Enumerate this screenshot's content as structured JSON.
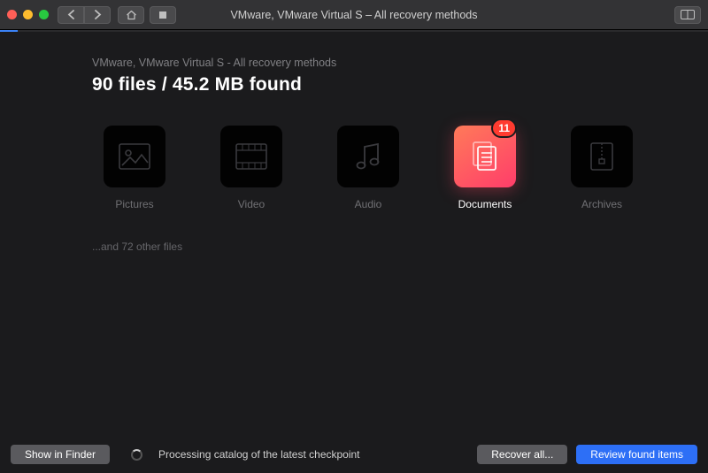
{
  "window": {
    "title": "VMware, VMware Virtual S – All recovery methods"
  },
  "page": {
    "breadcrumb": "VMware, VMware Virtual S - All recovery methods",
    "headline": "90 files / 45.2 MB found",
    "other_files": "...and 72 other files"
  },
  "categories": [
    {
      "key": "pictures",
      "label": "Pictures",
      "icon": "image-icon",
      "selected": false,
      "badge": null
    },
    {
      "key": "video",
      "label": "Video",
      "icon": "film-icon",
      "selected": false,
      "badge": null
    },
    {
      "key": "audio",
      "label": "Audio",
      "icon": "music-icon",
      "selected": false,
      "badge": null
    },
    {
      "key": "documents",
      "label": "Documents",
      "icon": "document-icon",
      "selected": true,
      "badge": "11"
    },
    {
      "key": "archives",
      "label": "Archives",
      "icon": "archive-icon",
      "selected": false,
      "badge": null
    }
  ],
  "footer": {
    "show_in_finder": "Show in Finder",
    "status": "Processing catalog of the latest checkpoint",
    "recover_all": "Recover all...",
    "review": "Review found items"
  },
  "colors": {
    "accent_gradient_from": "#ff7a59",
    "accent_gradient_to": "#ff3d6a",
    "primary_button": "#2d6ff6",
    "badge": "#ff3b30"
  }
}
